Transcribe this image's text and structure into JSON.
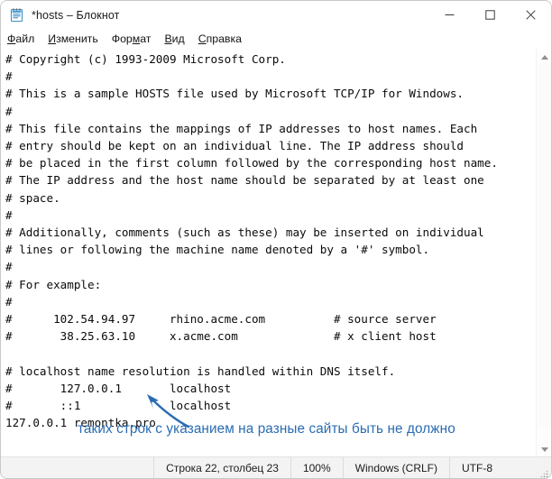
{
  "window": {
    "title": "*hosts – Блокнот",
    "icon": "notepad-icon",
    "controls": {
      "minimize": "minimize-icon",
      "maximize": "maximize-icon",
      "close": "close-icon"
    }
  },
  "menubar": {
    "items": [
      {
        "label": "Файл",
        "accesskey": "Ф",
        "rest": "айл"
      },
      {
        "label": "Изменить",
        "accesskey": "И",
        "rest": "зменить"
      },
      {
        "label": "Формат",
        "accesskey": "м",
        "pre": "Фор",
        "rest": "ат"
      },
      {
        "label": "Вид",
        "accesskey": "В",
        "rest": "ид"
      },
      {
        "label": "Справка",
        "accesskey": "С",
        "rest": "правка"
      }
    ]
  },
  "editor": {
    "content": "# Copyright (c) 1993-2009 Microsoft Corp.\n#\n# This is a sample HOSTS file used by Microsoft TCP/IP for Windows.\n#\n# This file contains the mappings of IP addresses to host names. Each\n# entry should be kept on an individual line. The IP address should\n# be placed in the first column followed by the corresponding host name.\n# The IP address and the host name should be separated by at least one\n# space.\n#\n# Additionally, comments (such as these) may be inserted on individual\n# lines or following the machine name denoted by a '#' symbol.\n#\n# For example:\n#\n#      102.54.94.97     rhino.acme.com          # source server\n#       38.25.63.10     x.acme.com              # x client host\n\n# localhost name resolution is handled within DNS itself.\n#       127.0.0.1       localhost\n#       ::1             localhost\n127.0.0.1 remontka.pro",
    "lines": [
      "# Copyright (c) 1993-2009 Microsoft Corp.",
      "#",
      "# This is a sample HOSTS file used by Microsoft TCP/IP for Windows.",
      "#",
      "# This file contains the mappings of IP addresses to host names. Each",
      "# entry should be kept on an individual line. The IP address should",
      "# be placed in the first column followed by the corresponding host name.",
      "# The IP address and the host name should be separated by at least one",
      "# space.",
      "#",
      "# Additionally, comments (such as these) may be inserted on individual",
      "# lines or following the machine name denoted by a '#' symbol.",
      "#",
      "# For example:",
      "#",
      "#      102.54.94.97     rhino.acme.com          # source server",
      "#       38.25.63.10     x.acme.com              # x client host",
      "",
      "# localhost name resolution is handled within DNS itself.",
      "#       127.0.0.1       localhost",
      "#       ::1             localhost",
      "127.0.0.1 remontka.pro"
    ]
  },
  "annotation": {
    "text": "таких строк с указанием на разные сайты быть не должно",
    "color": "#2a6cb3",
    "arrow": "curved-arrow-icon"
  },
  "scrollbar": {
    "up_arrow": "scroll-up-arrow-icon",
    "down_arrow": "scroll-down-arrow-icon"
  },
  "statusbar": {
    "position": "Строка 22, столбец 23",
    "zoom": "100%",
    "line_endings": "Windows (CRLF)",
    "encoding": "UTF-8"
  }
}
